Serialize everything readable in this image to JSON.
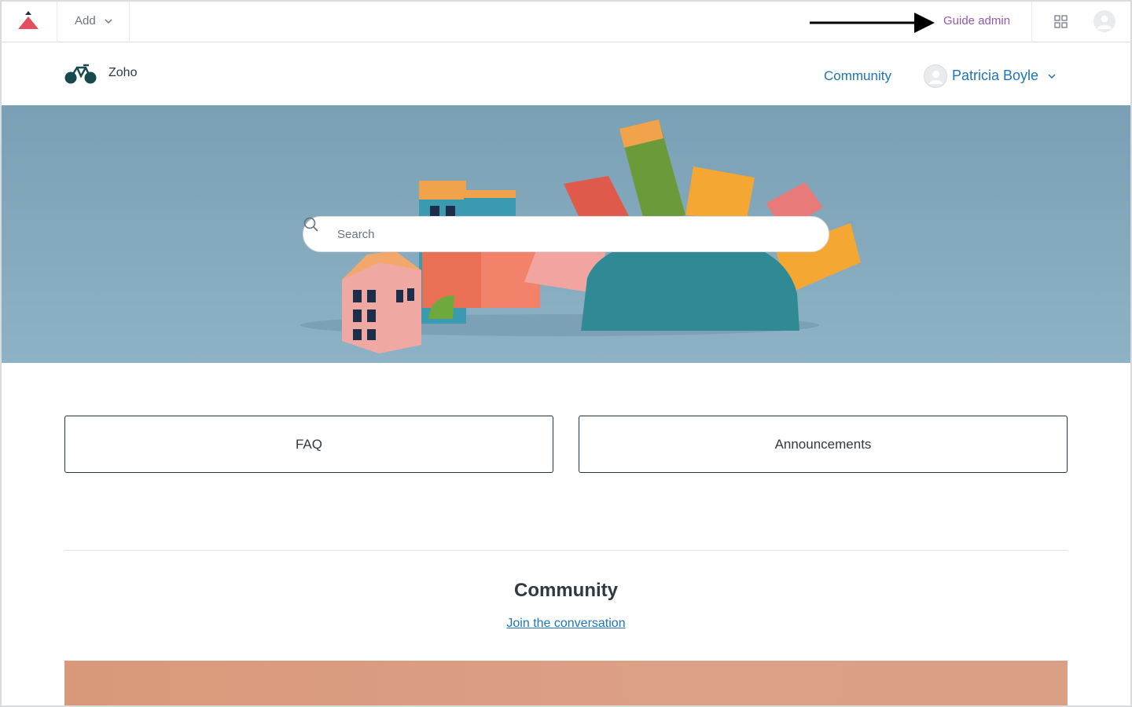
{
  "topbar": {
    "add_label": "Add",
    "guide_admin_label": "Guide admin"
  },
  "header": {
    "brand_name": "Zoho",
    "nav_community_label": "Community",
    "user_name": "Patricia Boyle"
  },
  "hero": {
    "search_placeholder": "Search"
  },
  "categories": [
    {
      "label": "FAQ"
    },
    {
      "label": "Announcements"
    }
  ],
  "community_section": {
    "title": "Community",
    "link_label": "Join the conversation"
  },
  "colors": {
    "accent_link": "#1f73b7",
    "guide_admin": "#9358b0",
    "hero_background": "#7fa3b6",
    "banner": "#d99879"
  },
  "icons": {
    "zendesk_logo": "red-triangle-logo",
    "brand_logo": "bicycle-logo",
    "apps": "grid-icon",
    "avatar": "user-avatar-icon",
    "search": "search-icon"
  }
}
